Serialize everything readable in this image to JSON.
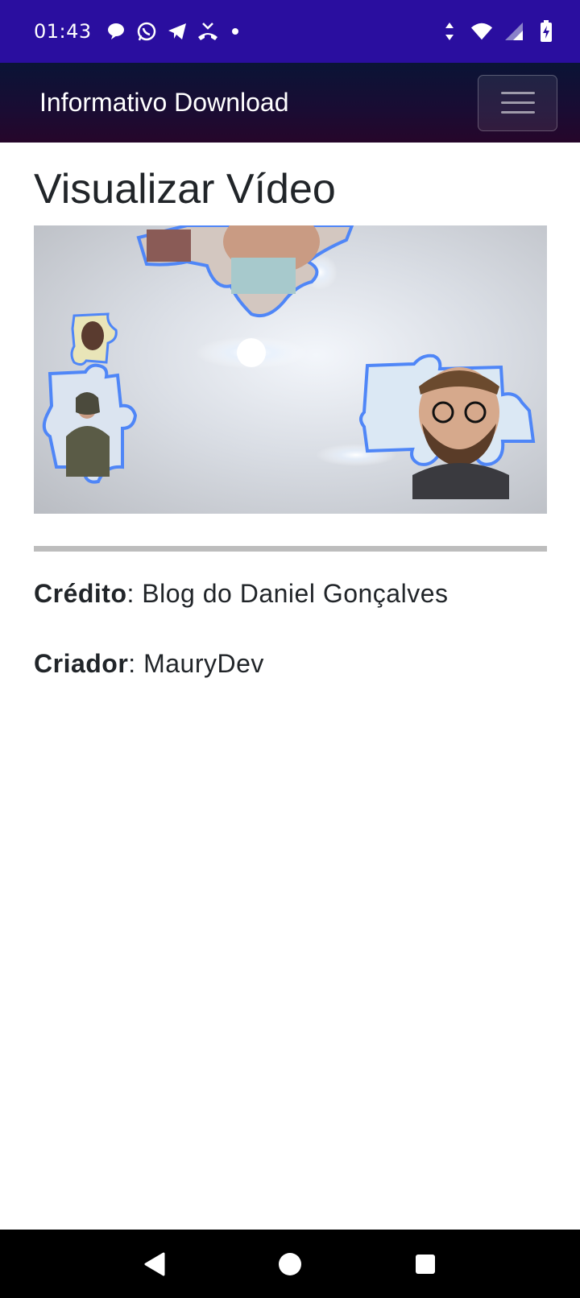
{
  "status_bar": {
    "time": "01:43",
    "left_icons": [
      "chat-bubble-icon",
      "whatsapp-icon",
      "telegram-icon",
      "missed-call-icon",
      "notification-dot-icon"
    ],
    "right_icons": [
      "data-arrows-icon",
      "wifi-icon",
      "cell-signal-icon",
      "battery-charging-icon"
    ]
  },
  "navbar": {
    "brand": "Informativo Download",
    "menu_icon": "hamburger-icon"
  },
  "main": {
    "title": "Visualizar Vídeo",
    "video_thumbnail": "puzzle-pieces-faces-image",
    "credit_label": "Crédito",
    "credit_value": ": Blog do Daniel Gonçalves",
    "creator_label": "Criador",
    "creator_value": ": MauryDev"
  },
  "system_nav": {
    "icons": [
      "back-icon",
      "home-icon",
      "recents-icon"
    ]
  },
  "colors": {
    "status_bar": "#2a0e9f",
    "navbar_top": "#0a1436",
    "navbar_bottom": "#26062a",
    "puzzle_outline": "#4f86f7"
  }
}
